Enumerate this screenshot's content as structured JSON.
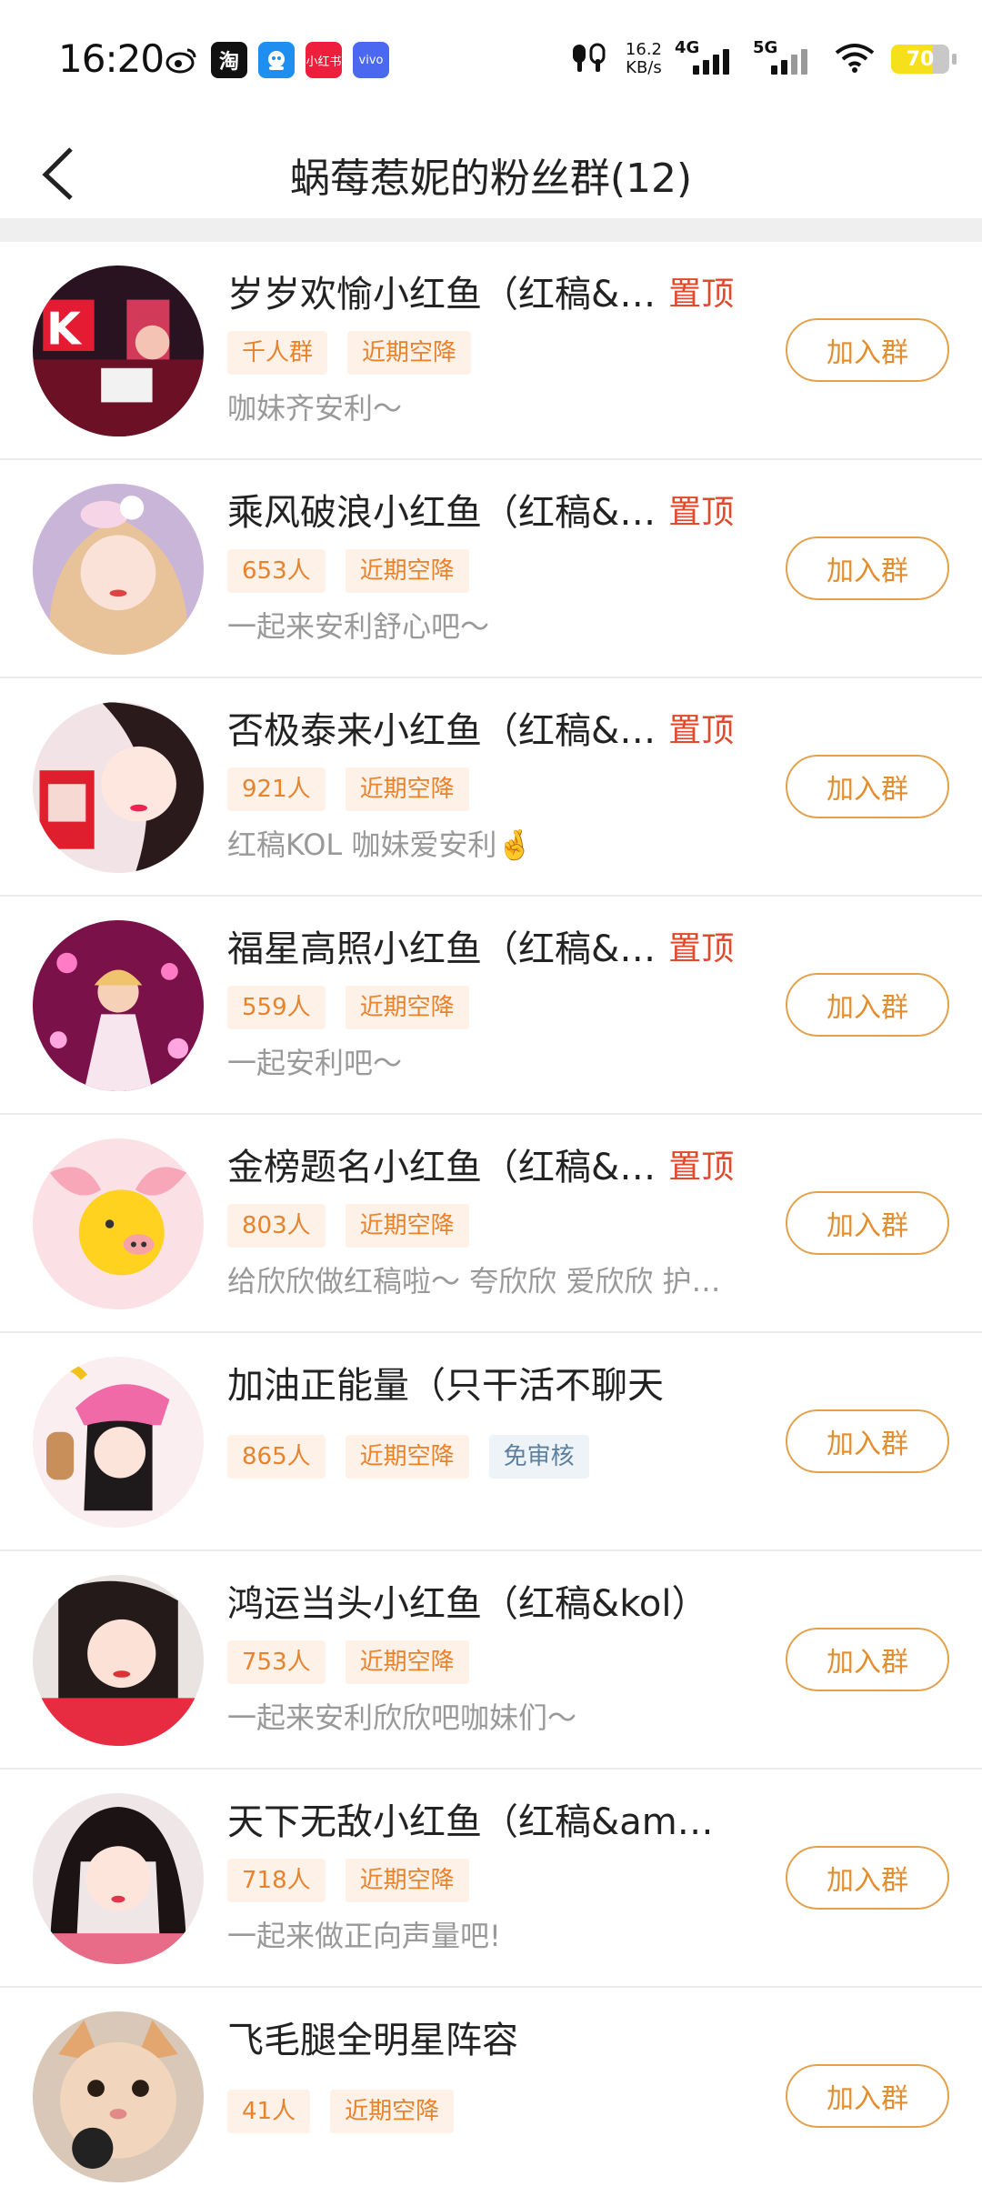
{
  "status_bar": {
    "time": "16:20",
    "net_speed_value": "16.2",
    "net_speed_unit": "KB/s",
    "sig1_label": "4G",
    "sig2_label": "5G",
    "battery": "70",
    "notif_icons": [
      "weibo-icon",
      "taobao-icon",
      "robot-app-icon",
      "xiaohongshu-icon",
      "vivo-icon"
    ],
    "notif_xhs_text": "小红书",
    "notif_vivo_text": "vivo"
  },
  "header": {
    "title": "蜗莓惹妮的粉丝群(12)"
  },
  "join_label": "加入群",
  "groups": [
    {
      "name": "岁岁欢愉小红鱼（红稿&…",
      "pinned": "置顶",
      "tags": [
        "千人群",
        "近期空降"
      ],
      "desc": "咖妹齐安利～"
    },
    {
      "name": "乘风破浪小红鱼（红稿&…",
      "pinned": "置顶",
      "tags": [
        "653人",
        "近期空降"
      ],
      "desc": "一起来安利舒心吧～"
    },
    {
      "name": "否极泰来小红鱼（红稿&…",
      "pinned": "置顶",
      "tags": [
        "921人",
        "近期空降"
      ],
      "desc": "红稿KOL 咖妹爱安利🤞"
    },
    {
      "name": "福星高照小红鱼（红稿&…",
      "pinned": "置顶",
      "tags": [
        "559人",
        "近期空降"
      ],
      "desc": "一起安利吧～"
    },
    {
      "name": "金榜题名小红鱼（红稿&…",
      "pinned": "置顶",
      "tags": [
        "803人",
        "近期空降"
      ],
      "desc": "给欣欣做红稿啦～ 夸欣欣 爱欣欣 护…"
    },
    {
      "name": "加油正能量（只干活不聊天",
      "pinned": "",
      "tags": [
        "865人",
        "近期空降",
        "免审核"
      ],
      "desc": ""
    },
    {
      "name": "鸿运当头小红鱼（红稿&kol）",
      "pinned": "",
      "tags": [
        "753人",
        "近期空降"
      ],
      "desc": "一起来安利欣欣吧咖妹们～"
    },
    {
      "name": "天下无敌小红鱼（红稿&am…",
      "pinned": "",
      "tags": [
        "718人",
        "近期空降"
      ],
      "desc": "一起来做正向声量吧!"
    },
    {
      "name": "飞毛腿全明星阵容",
      "pinned": "",
      "tags": [
        "41人",
        "近期空降"
      ],
      "desc": ""
    }
  ]
}
